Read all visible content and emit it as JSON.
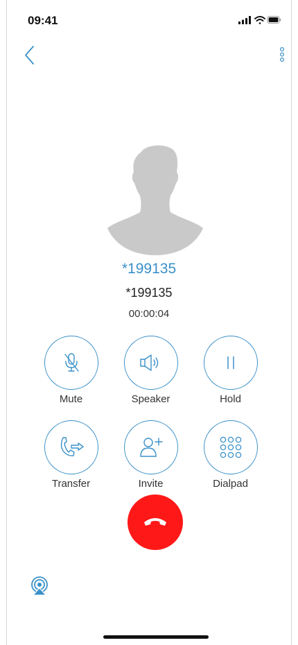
{
  "status_bar": {
    "time": "09:41",
    "icons": [
      "cellular-signal-icon",
      "wifi-icon",
      "battery-icon"
    ]
  },
  "nav": {
    "back_icon": "chevron-left-icon",
    "more_icon": "vertical-dots-icon"
  },
  "call": {
    "display_name": "*199135",
    "number": "*199135",
    "duration": "00:00:04"
  },
  "controls": [
    {
      "label": "Mute",
      "icon": "mic-off-icon"
    },
    {
      "label": "Speaker",
      "icon": "speaker-icon"
    },
    {
      "label": "Hold",
      "icon": "pause-icon"
    },
    {
      "label": "Transfer",
      "icon": "phone-transfer-icon"
    },
    {
      "label": "Invite",
      "icon": "add-user-icon"
    },
    {
      "label": "Dialpad",
      "icon": "dialpad-icon"
    }
  ],
  "hangup": {
    "icon": "end-call-icon"
  },
  "airplay": {
    "icon": "airplay-icon"
  },
  "colors": {
    "accent": "#3a90c8",
    "hangup": "#ff1818",
    "avatar": "#c9c9c9"
  }
}
